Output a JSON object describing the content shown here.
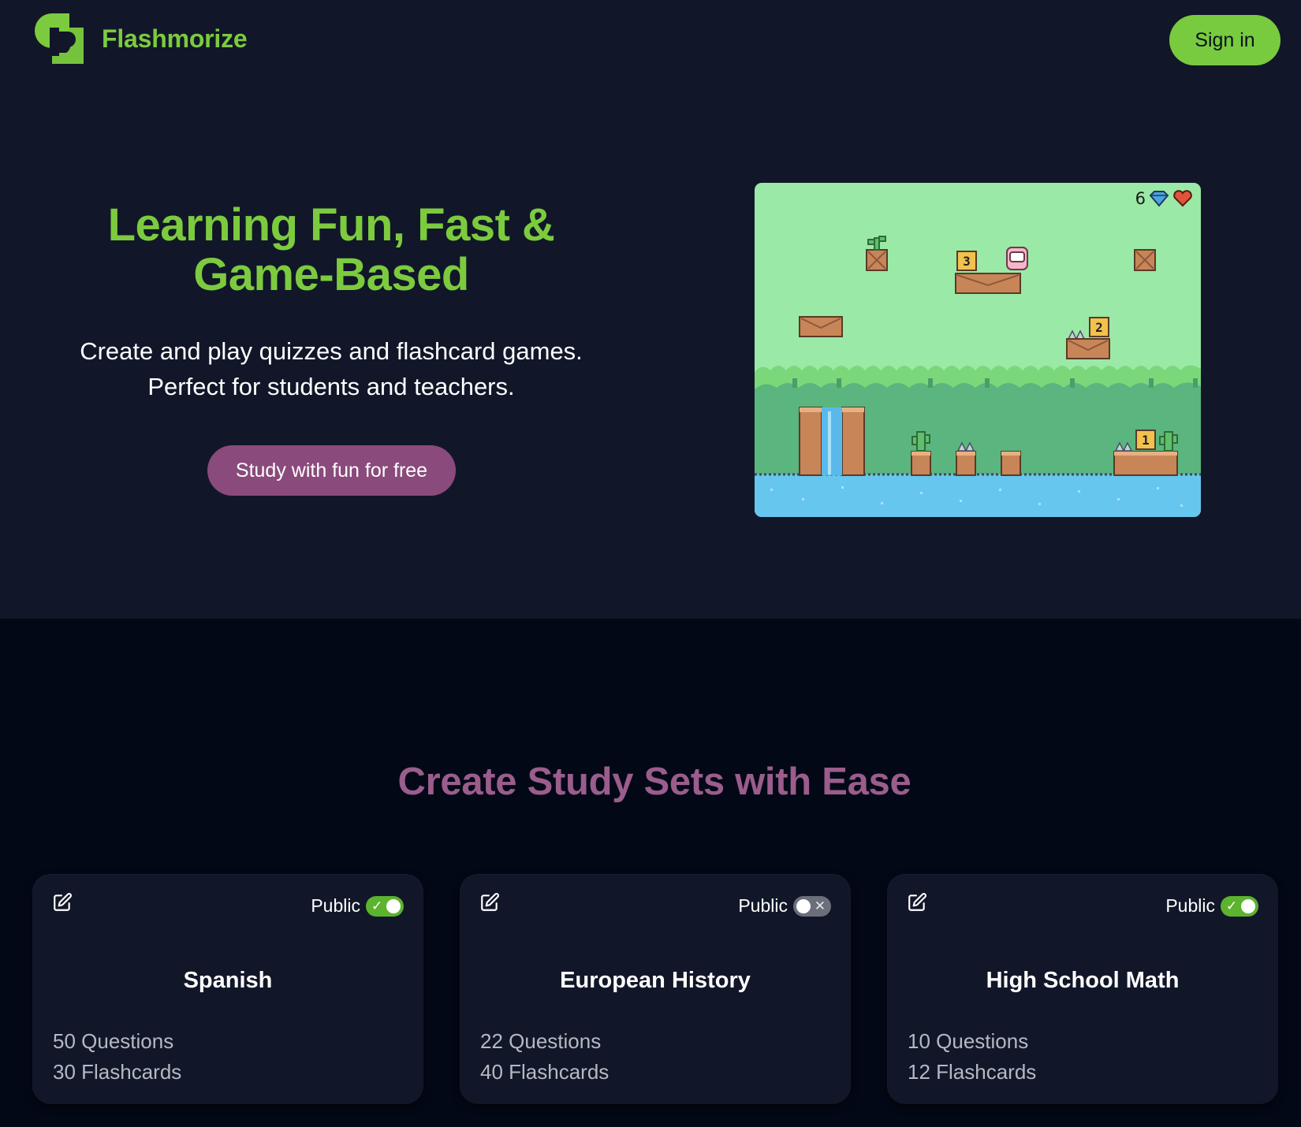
{
  "header": {
    "brand": "Flashmorize",
    "signin_label": "Sign in",
    "logo_icon": "flashmorize-logo-icon"
  },
  "hero": {
    "title_line1": "Learning Fun, Fast &",
    "title_line2": "Game-Based",
    "subtitle_line1": "Create and play quizzes and flashcard games.",
    "subtitle_line2": "Perfect for students and teachers.",
    "cta_label": "Study with fun for free",
    "game_preview": {
      "gems": "6",
      "gem_icon": "diamond-icon",
      "life_icon": "heart-icon",
      "box_numbers": [
        "3",
        "2",
        "1"
      ]
    }
  },
  "sets": {
    "title": "Create Study Sets with Ease",
    "public_label": "Public",
    "items": [
      {
        "name": "Spanish",
        "questions": "50 Questions",
        "flashcards": "30 Flashcards",
        "public": true
      },
      {
        "name": "European History",
        "questions": "22 Questions",
        "flashcards": "40 Flashcards",
        "public": false
      },
      {
        "name": "High School Math",
        "questions": "10 Questions",
        "flashcards": "12 Flashcards",
        "public": true
      }
    ]
  },
  "colors": {
    "brand_green": "#7ccb3e",
    "accent_purple": "#8a4a7c",
    "section_title": "#9a5d8c",
    "hero_bg": "#111729",
    "page_bg": "#030816"
  }
}
